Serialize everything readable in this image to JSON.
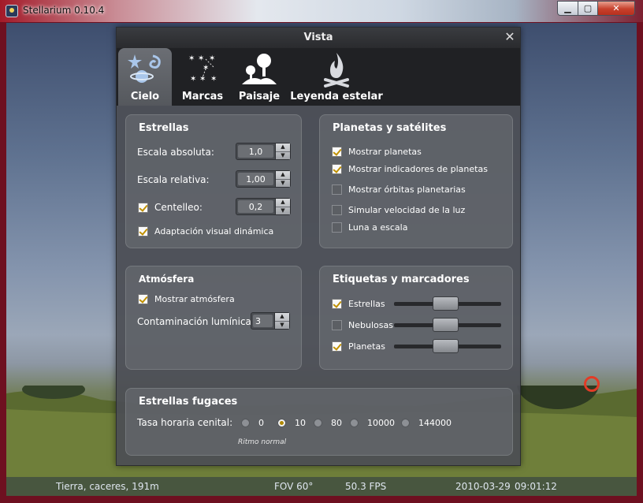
{
  "window": {
    "title": "Stellarium 0.10.4",
    "controls": [
      "minimize",
      "maximize",
      "close"
    ]
  },
  "dialog": {
    "title": "Vista",
    "tabs": [
      {
        "label": "Cielo",
        "icon": "galaxy-icon",
        "active": true
      },
      {
        "label": "Marcas",
        "icon": "constellation-icon",
        "active": false
      },
      {
        "label": "Paisaje",
        "icon": "landscape-icon",
        "active": false
      },
      {
        "label": "Leyenda estelar",
        "icon": "campfire-icon",
        "active": false
      }
    ],
    "stars": {
      "title": "Estrellas",
      "absolute_scale": {
        "label": "Escala absoluta:",
        "value": "1,0"
      },
      "relative_scale": {
        "label": "Escala relativa:",
        "value": "1,00"
      },
      "twinkle": {
        "label": "Centelleo:",
        "checked": true,
        "value": "0,2"
      },
      "dynamic_eye": {
        "label": "Adaptación visual dinámica",
        "checked": true
      }
    },
    "planets": {
      "title": "Planetas y satélites",
      "options": [
        {
          "label": "Mostrar planetas",
          "checked": true
        },
        {
          "label": "Mostrar indicadores de planetas",
          "checked": true
        },
        {
          "label": "Mostrar órbitas planetarias",
          "checked": false
        },
        {
          "label": "Simular velocidad de la luz",
          "checked": false
        },
        {
          "label": "Luna a escala",
          "checked": false
        }
      ]
    },
    "atmosphere": {
      "title": "Atmósfera",
      "show": {
        "label": "Mostrar atmósfera",
        "checked": true
      },
      "light_pollution": {
        "label": "Contaminación lumínica",
        "value": "3"
      }
    },
    "labels": {
      "title": "Etiquetas y marcadores",
      "items": [
        {
          "label": "Estrellas",
          "checked": true,
          "level": 0.36
        },
        {
          "label": "Nebulosas",
          "checked": false,
          "level": 0.36
        },
        {
          "label": "Planetas",
          "checked": true,
          "level": 0.36
        }
      ]
    },
    "meteors": {
      "title": "Estrellas fugaces",
      "rate_label": "Tasa horaria cenital:",
      "options": [
        "0",
        "10",
        "80",
        "10000",
        "144000"
      ],
      "selected": "10",
      "note": "Ritmo normal"
    }
  },
  "status": {
    "location": "Tierra, caceres, 191m",
    "fov": "FOV 60°",
    "fps": "50.3 FPS",
    "date": "2010-03-29",
    "time": "09:01:12"
  },
  "colors": {
    "accent": "#c09000",
    "planet_marker": "#e23b26"
  }
}
